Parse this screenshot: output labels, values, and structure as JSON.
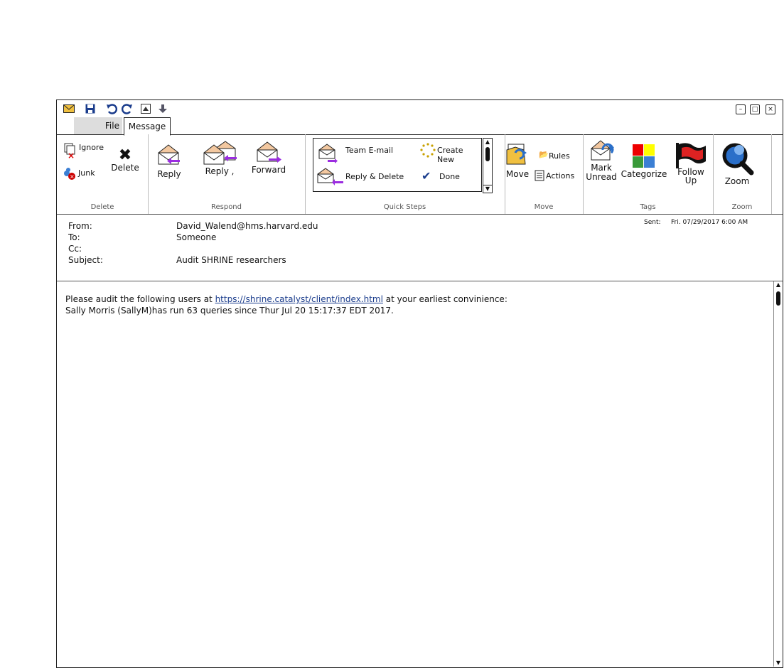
{
  "quick_access": {
    "icons": [
      "mail-icon",
      "save-icon",
      "undo-icon",
      "redo-icon",
      "up-icon",
      "down-icon"
    ]
  },
  "tabs": [
    {
      "label": "File"
    },
    {
      "label": "Message"
    }
  ],
  "ribbon": {
    "delete": {
      "label": "Delete",
      "ignore": "Ignore",
      "junk": "Junk",
      "delete_btn": "Delete"
    },
    "respond": {
      "label": "Respond",
      "reply": "Reply",
      "reply_all": "Reply ,",
      "forward": "Forward"
    },
    "quick_steps": {
      "label": "Quick Steps",
      "team_email": "Team E-mail",
      "create_new": "Create New",
      "reply_delete": "Reply & Delete",
      "done": "Done"
    },
    "move": {
      "label": "Move",
      "move_btn": "Move",
      "rules": "Rules",
      "actions": "Actions"
    },
    "tags": {
      "label": "Tags",
      "mark_unread": [
        "Mark",
        "Unread"
      ],
      "categorize": "Categorize",
      "follow_up": [
        "Follow",
        "Up"
      ]
    },
    "zoom": {
      "label": "Zoom",
      "zoom_btn": "Zoom"
    }
  },
  "message": {
    "from_label": "From:",
    "from": "David_Walend@hms.harvard.edu",
    "to_label": "To:",
    "to": "Someone",
    "cc_label": "Cc:",
    "cc": "",
    "subject_label": "Subject:",
    "subject": "Audit SHRINE researchers",
    "sent_label": "Sent:",
    "sent": "Fri. 07/29/2017  6:00 AM"
  },
  "body": {
    "line1_pre": "Please audit the following users at ",
    "link": "https://shrine.catalyst/client/index.html",
    "line1_post": " at your earliest convinience:",
    "line2": "Sally Morris (SallyM)has run 63 queries since Thur Jul 20 15:17:37 EDT 2017."
  },
  "colors": {
    "envelope": "#f3c8a0",
    "arrow": "#9b2de0",
    "flag": "#d22",
    "cat_red": "#e00",
    "cat_yellow": "#ff0",
    "cat_green": "#3a9a3a",
    "cat_blue": "#3b7fd4",
    "zoom": "#2a6fc9"
  }
}
